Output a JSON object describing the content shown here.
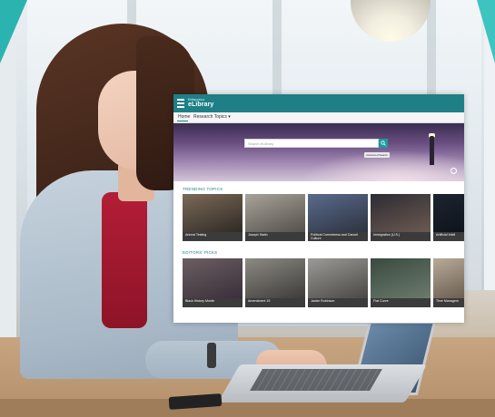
{
  "app": {
    "brand_small": "Britannica",
    "brand_name": "eLibrary"
  },
  "nav": {
    "items": [
      {
        "label": "Home"
      },
      {
        "label": "Research Topics ▾"
      }
    ]
  },
  "hero": {
    "search_placeholder": "Search eLibrary",
    "advanced_label": "Advanced Search"
  },
  "sections": {
    "trending": {
      "title": "TRENDING TOPICS",
      "cards": [
        {
          "label": "Animal Testing",
          "color_top": "#7b6a58",
          "color_bottom": "#2f2a25"
        },
        {
          "label": "Joseph Stalin",
          "color_top": "#a8a39a",
          "color_bottom": "#55514b"
        },
        {
          "label": "Political Correctness and Cancel Culture",
          "color_top": "#5a6b8c",
          "color_bottom": "#2d3340"
        },
        {
          "label": "Immigration (U.S.)",
          "color_top": "#2d2b36",
          "color_bottom": "#6b5a4f"
        },
        {
          "label": "Artificial Intell",
          "color_top": "#1c2431",
          "color_bottom": "#0f141b"
        }
      ]
    },
    "editors": {
      "title": "EDITORS' PICKS",
      "cards": [
        {
          "label": "Black History Month",
          "color_top": "#6b5f62",
          "color_bottom": "#3a2f3a"
        },
        {
          "label": "Amendment 19",
          "color_top": "#8d8a84",
          "color_bottom": "#3e3c39"
        },
        {
          "label": "Jackie Robinson",
          "color_top": "#9c9a96",
          "color_bottom": "#4a4846"
        },
        {
          "label": "Flat Curve",
          "color_top": "#3a4a40",
          "color_bottom": "#6a7a6c"
        },
        {
          "label": "Time Managem",
          "color_top": "#b8aa98",
          "color_bottom": "#6d5f51"
        }
      ]
    }
  },
  "colors": {
    "header": "#1f7f86",
    "accent": "#1f9a9f"
  }
}
